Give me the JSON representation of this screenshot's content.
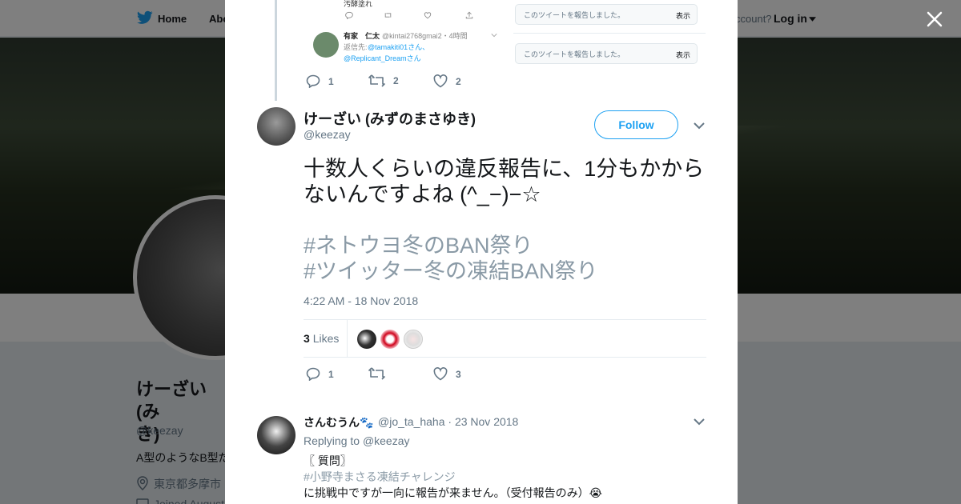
{
  "colors": {
    "brand": "#1da1f2",
    "muted": "#657786",
    "text": "#14171a",
    "hashtag": "#8a9aa6",
    "border": "#e6ecf0"
  },
  "background_page": {
    "nav": {
      "home_label": "Home",
      "about_label": "Abo",
      "account_prompt": "ccount?",
      "login_label": "Log in"
    },
    "profile": {
      "name": "けーざい (み",
      "name_line2": "き)",
      "handle": "@keezay",
      "bio": "A型のようなB型だ",
      "location": "東京都多摩市",
      "joined": "Joined August"
    }
  },
  "modal": {
    "embedded_screenshot": {
      "top_text": "汚酵塗れ",
      "mini_name": "有家　仁太",
      "mini_handle": "@kintai2768gmai2・4時間",
      "mini_reply_prefix": "返信先:",
      "mini_reply_link1": "@tamakiti01さん、",
      "mini_reply_link2": "@Replicant_Dreamさん",
      "notice_text": "このツイートを報告しました。",
      "notice_show": "表示"
    },
    "parent_actions": {
      "replies": "1",
      "retweets": "2",
      "likes": "2"
    },
    "tweet": {
      "name": "けーざい (みずのまさゆき)",
      "handle": "@keezay",
      "follow_label": "Follow",
      "text": "十数人くらいの違反報告に、1分もかからないんですよね (^_−)−☆",
      "hashtag1": "#ネトウヨ冬のBAN祭り",
      "hashtag2": "#ツイッター冬の凍結BAN祭り",
      "timestamp": "4:22 AM - 18 Nov 2018",
      "likes_count": "3",
      "likes_label": "Likes",
      "actions": {
        "replies": "1",
        "retweets": "",
        "likes": "3"
      }
    },
    "reply": {
      "name": "さんむうん🐾",
      "handle_date": "@jo_ta_haha · 23 Nov 2018",
      "replying_prefix": "Replying to",
      "replying_handle": "@keezay",
      "line1": "〖 質問〗",
      "line2": "#小野寺まさる凍結チャレンジ",
      "line3": "に挑戦中ですが一向に報告が来ません。（受付報告のみ）😭"
    }
  }
}
